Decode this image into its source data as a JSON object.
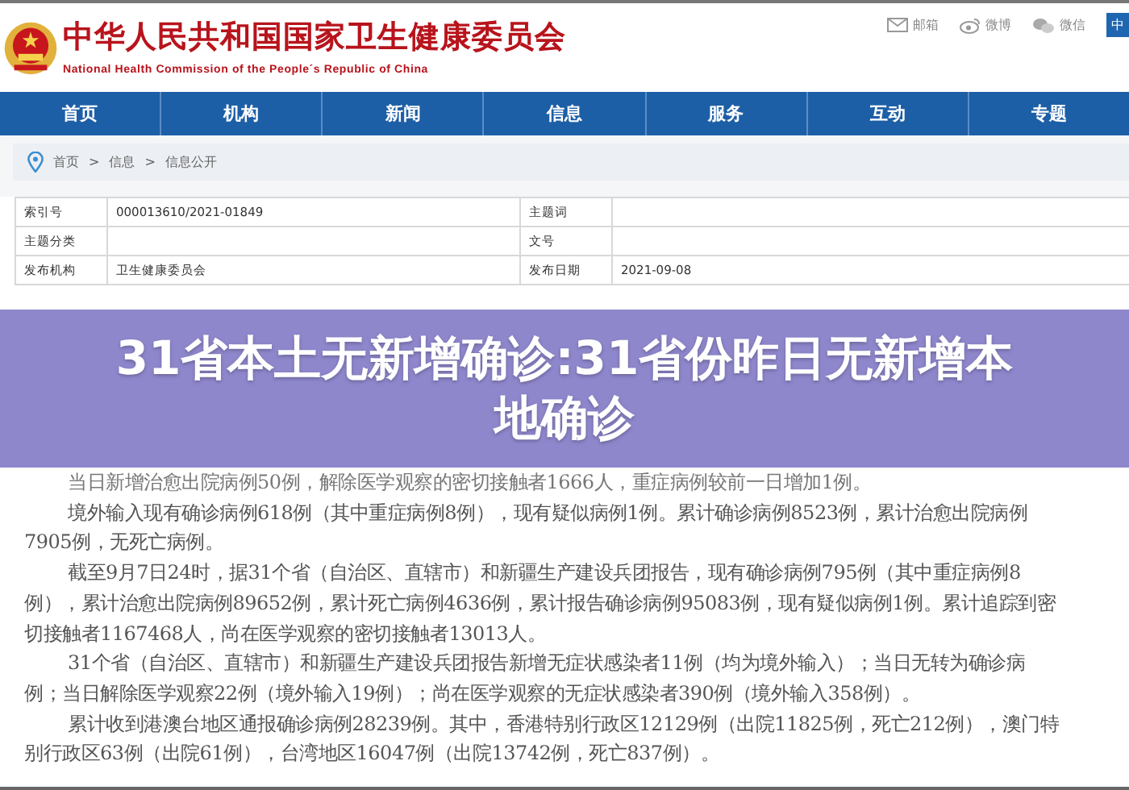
{
  "header": {
    "title": "中华人民共和国国家卫生健康委员会",
    "subtitle": "National Health Commission of the People´s Republic of China",
    "links": [
      {
        "kind": "mail",
        "label": "邮箱"
      },
      {
        "kind": "weibo",
        "label": "微博"
      },
      {
        "kind": "wechat",
        "label": "微信"
      }
    ],
    "languages": [
      {
        "label": "中",
        "selected": true
      }
    ]
  },
  "nav": [
    "首页",
    "机构",
    "新闻",
    "信息",
    "服务",
    "互动",
    "专题"
  ],
  "breadcrumb": [
    "首页",
    ">",
    "信息",
    ">",
    "信息公开"
  ],
  "info_table": [
    [
      {
        "label": "索引号",
        "value": "000013610/2021-01849"
      },
      {
        "label": "主题词"
      }
    ],
    [
      {
        "label": "主题分类"
      },
      {
        "label": "文号"
      }
    ],
    [
      {
        "label": "发布机构",
        "value": "卫生健康委员会"
      },
      {
        "label": "发布日期",
        "value": "2021-09-08"
      }
    ]
  ],
  "banner": {
    "title": "31省本土无新增确诊:31省份昨日无新增本地确诊"
  },
  "article": [
    {
      "lines": [
        "当日新增治愈出院病例50例，解除医学观察的密切接触者1666人，重症病例较前一日增加1例。"
      ],
      "continued": true
    },
    {
      "lines": [
        "境外输入现有确诊病例618例（其中重症病例8例），现有疑似病例1例。累计确诊病例8523例，累计治愈出院病例",
        "7905例，无死亡病例。"
      ],
      "continued": false
    },
    {
      "lines": [
        "截至9月7日24时，据31个省（自治区、直辖市）和新疆生产建设兵团报告，现有确诊病例795例（其中重症病例8",
        "例），累计治愈出院病例89652例，累计死亡病例4636例，累计报告确诊病例95083例，现有疑似病例1例。累计追踪到密",
        "切接触者1167468人，尚在医学观察的密切接触者13013人。"
      ],
      "continued": false
    },
    {
      "lines": [
        "31个省（自治区、直辖市）和新疆生产建设兵团报告新增无症状感染者11例（均为境外输入）；当日无转为确诊病",
        "例；当日解除医学观察22例（境外输入19例）；尚在医学观察的无症状感染者390例（境外输入358例）。"
      ],
      "continued": false
    },
    {
      "lines": [
        "累计收到港澳台地区通报确诊病例28239例。其中，香港特别行政区12129例（出院11825例，死亡212例），澳门特",
        "别行政区63例（出院61例），台湾地区16047例（出院13742例，死亡837例）。"
      ],
      "continued": false
    }
  ]
}
